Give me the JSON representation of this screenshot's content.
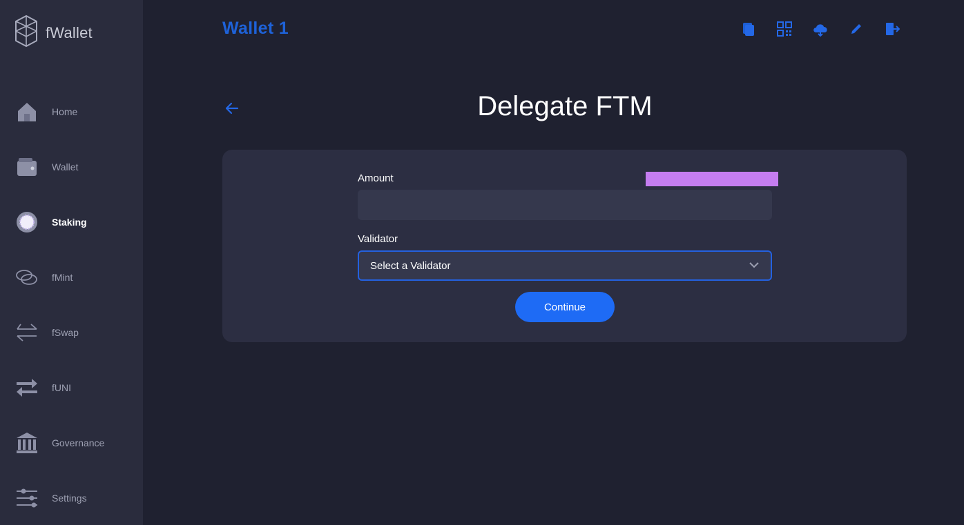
{
  "app": {
    "name": "fWallet"
  },
  "sidebar": {
    "items": [
      {
        "label": "Home",
        "icon": "house-icon",
        "active": false
      },
      {
        "label": "Wallet",
        "icon": "wallet-icon",
        "active": false
      },
      {
        "label": "Staking",
        "icon": "staking-icon",
        "active": true
      },
      {
        "label": "fMint",
        "icon": "coins-icon",
        "active": false
      },
      {
        "label": "fSwap",
        "icon": "swap-icon",
        "active": false
      },
      {
        "label": "fUNI",
        "icon": "exchange-arrows-icon",
        "active": false
      },
      {
        "label": "Governance",
        "icon": "bank-icon",
        "active": false
      },
      {
        "label": "Settings",
        "icon": "sliders-icon",
        "active": false
      }
    ]
  },
  "header": {
    "wallet_title": "Wallet 1",
    "icons": [
      "copy-icon",
      "qr-code-icon",
      "cloud-download-icon",
      "pencil-icon",
      "logout-icon"
    ]
  },
  "page": {
    "title": "Delegate FTM"
  },
  "form": {
    "amount_label": "Amount",
    "amount_value": "",
    "validator_label": "Validator",
    "validator_selected": "Select a Validator",
    "continue_label": "Continue"
  },
  "colors": {
    "accent": "#1e6bf5",
    "title_blue": "#1e62d8",
    "background": "#1f2130",
    "sidebar": "#2a2c3d",
    "card": "#2c2e42",
    "redaction": "#c57df0"
  }
}
